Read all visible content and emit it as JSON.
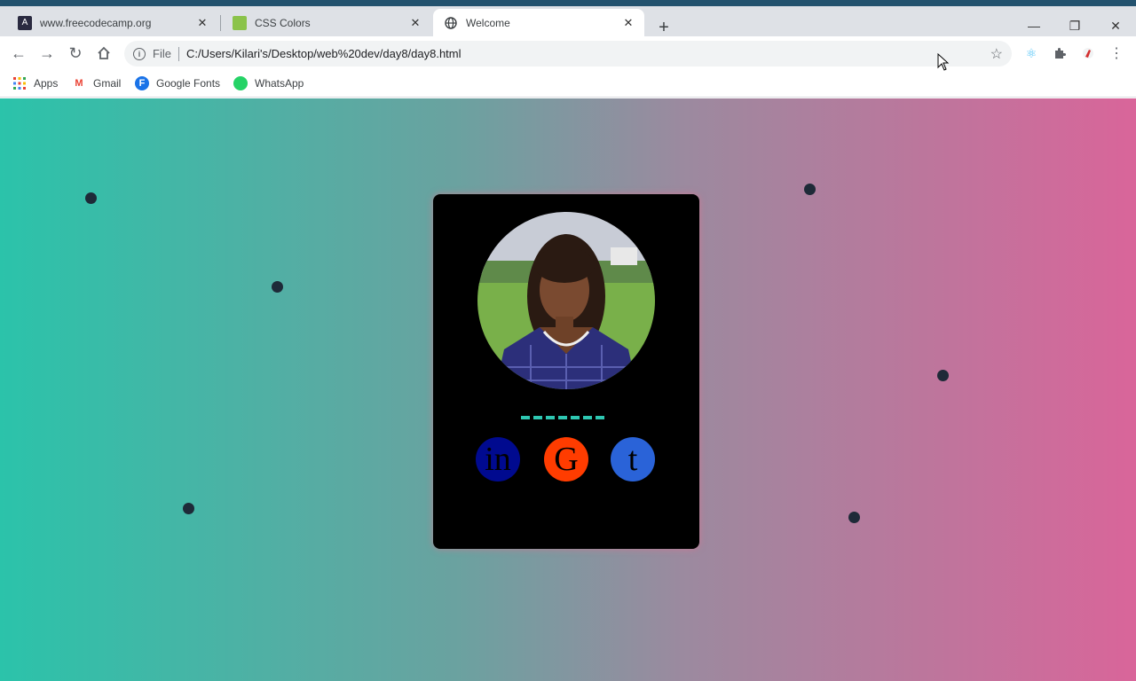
{
  "browser": {
    "tabs": [
      {
        "title": "www.freecodecamp.org",
        "favicon": "freecodecamp-icon",
        "active": false
      },
      {
        "title": "CSS Colors",
        "favicon": "css-colors-icon",
        "active": false
      },
      {
        "title": "Welcome",
        "favicon": "globe-icon",
        "active": true
      }
    ],
    "address": {
      "scheme": "File",
      "url": "C:/Users/Kilari's/Desktop/web%20dev/day8/day8.html"
    },
    "bookmarks": [
      {
        "label": "Apps",
        "icon": "apps-grid-icon"
      },
      {
        "label": "Gmail",
        "icon": "gmail-icon"
      },
      {
        "label": "Google Fonts",
        "icon": "google-fonts-icon"
      },
      {
        "label": "WhatsApp",
        "icon": "whatsapp-icon"
      }
    ]
  },
  "page": {
    "social_buttons": [
      {
        "glyph": "in",
        "icon": "linkedin-icon",
        "color": "#000a8f"
      },
      {
        "glyph": "G",
        "icon": "google-icon",
        "color": "#ff3c00"
      },
      {
        "glyph": "t",
        "icon": "twitter-icon",
        "color": "#2a63d8"
      }
    ],
    "colors": {
      "gradient_start": "#2bc3aa",
      "gradient_end": "#d9659a",
      "card_background": "#000000",
      "dash_color": "#2ec7b2",
      "dot_color": "#1e2a38"
    }
  }
}
